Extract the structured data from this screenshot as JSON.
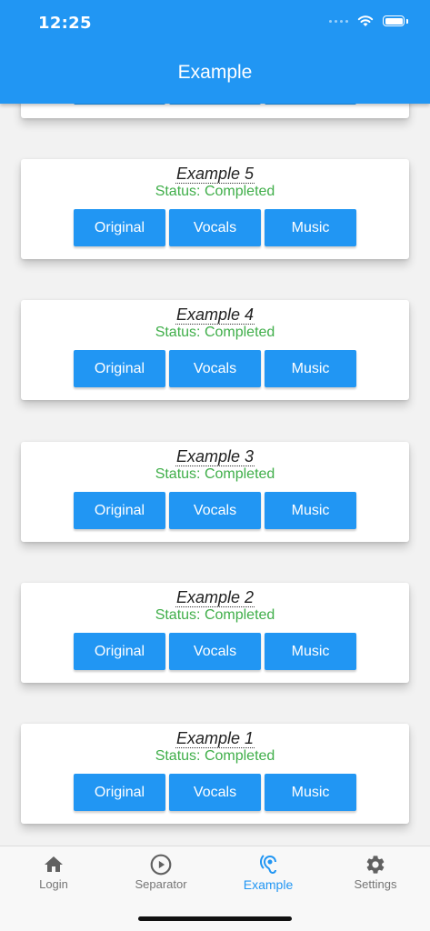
{
  "status_bar": {
    "time": "12:25"
  },
  "appbar": {
    "title": "Example"
  },
  "cards": [
    {
      "title": "Example 5",
      "status": "Status: Completed",
      "buttons": [
        "Original",
        "Vocals",
        "Music"
      ]
    },
    {
      "title": "Example 4",
      "status": "Status: Completed",
      "buttons": [
        "Original",
        "Vocals",
        "Music"
      ]
    },
    {
      "title": "Example 3",
      "status": "Status: Completed",
      "buttons": [
        "Original",
        "Vocals",
        "Music"
      ]
    },
    {
      "title": "Example 2",
      "status": "Status: Completed",
      "buttons": [
        "Original",
        "Vocals",
        "Music"
      ]
    },
    {
      "title": "Example 1",
      "status": "Status: Completed",
      "buttons": [
        "Original",
        "Vocals",
        "Music"
      ]
    }
  ],
  "bottom_nav": {
    "items": [
      {
        "label": "Login",
        "icon": "home-icon"
      },
      {
        "label": "Separator",
        "icon": "play-circle-icon"
      },
      {
        "label": "Example",
        "icon": "hearing-icon",
        "active": true
      },
      {
        "label": "Settings",
        "icon": "gear-icon"
      }
    ]
  },
  "colors": {
    "primary": "#2196f3",
    "status_completed": "#3fae49"
  }
}
